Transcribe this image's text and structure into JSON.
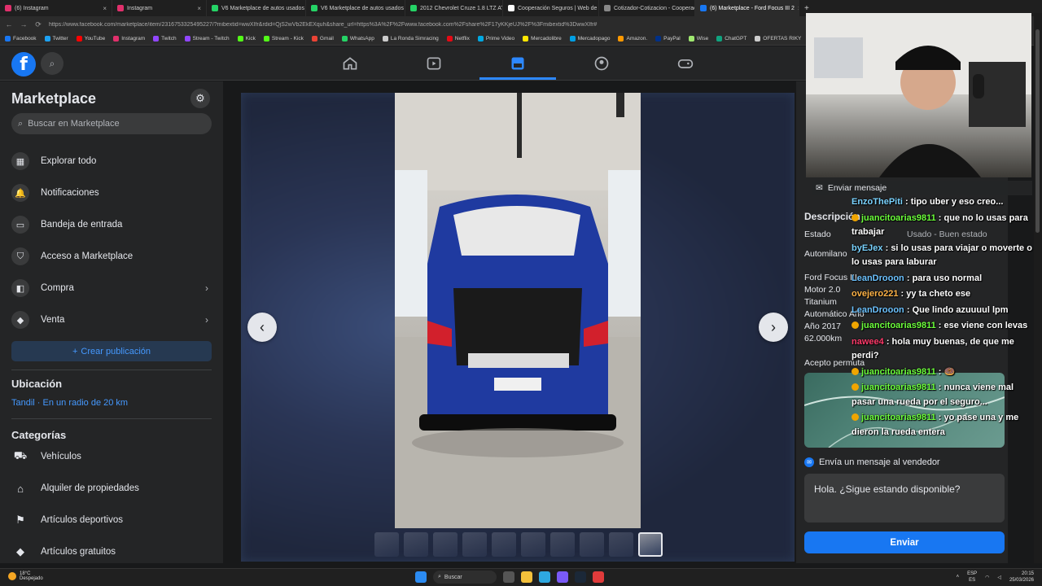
{
  "browser": {
    "tabs": [
      {
        "label": "(6) Instagram",
        "color": "#e1306c",
        "active": false
      },
      {
        "label": "Instagram",
        "color": "#e1306c",
        "active": false
      },
      {
        "label": "V6 Marketplace de autos usados",
        "color": "#25d366",
        "active": false
      },
      {
        "label": "V6 Marketplace de autos usados",
        "color": "#25d366",
        "active": false
      },
      {
        "label": "2012 Chevrolet Cruze 1.8 LTZ AT",
        "color": "#25d366",
        "active": false
      },
      {
        "label": "Cooperación Seguros | Web de Cl",
        "color": "#ffffff",
        "active": false
      },
      {
        "label": "Cotizador-Cotizacion - Cooperaci",
        "color": "#888888",
        "active": false
      },
      {
        "label": "(6) Marketplace - Ford Focus III 2",
        "color": "#1877f2",
        "active": true
      }
    ],
    "new_tab": "+",
    "url": "https://www.facebook.com/marketplace/item/2316753325495227/?mibextid=wwXIfr&rdid=QjS2wVb2EkEXquh&share_url=https%3A%2F%2Fwww.facebook.com%2Fshare%2F17yKKjeUJ%2F%3Fmibextid%3DwwXIfr#",
    "bookmarks": [
      {
        "label": "Facebook",
        "color": "#1877f2"
      },
      {
        "label": "Twitter",
        "color": "#1da1f2"
      },
      {
        "label": "YouTube",
        "color": "#ff0000"
      },
      {
        "label": "Instagram",
        "color": "#e1306c"
      },
      {
        "label": "Twitch",
        "color": "#9146ff"
      },
      {
        "label": "Stream - Twitch",
        "color": "#9146ff"
      },
      {
        "label": "Kick",
        "color": "#53fc18"
      },
      {
        "label": "Stream - Kick",
        "color": "#53fc18"
      },
      {
        "label": "Gmail",
        "color": "#ea4335"
      },
      {
        "label": "WhatsApp",
        "color": "#25d366"
      },
      {
        "label": "La Ronda Simracing",
        "color": "#cccccc"
      },
      {
        "label": "Netflix",
        "color": "#e50914"
      },
      {
        "label": "Prime Video",
        "color": "#00a8e1"
      },
      {
        "label": "Mercadolibre",
        "color": "#ffe600"
      },
      {
        "label": "Mercadopago",
        "color": "#009ee3"
      },
      {
        "label": "Amazon.",
        "color": "#ff9900"
      },
      {
        "label": "PayPal",
        "color": "#003087"
      },
      {
        "label": "Wise",
        "color": "#9fe870"
      },
      {
        "label": "ChatGPT",
        "color": "#10a37f"
      },
      {
        "label": "OFERTAS RIKY",
        "color": "#cccccc"
      }
    ]
  },
  "fb": {
    "logo": "f",
    "accent": "#1877f2"
  },
  "sidebar": {
    "title": "Marketplace",
    "search_placeholder": "Buscar en Marketplace",
    "items": [
      {
        "label": "Explorar todo",
        "icon": "store-icon",
        "glyph": "▦",
        "chevron": false
      },
      {
        "label": "Notificaciones",
        "icon": "bell-icon",
        "glyph": "🔔",
        "chevron": false
      },
      {
        "label": "Bandeja de entrada",
        "icon": "inbox-icon",
        "glyph": "▭",
        "chevron": false
      },
      {
        "label": "Acceso a Marketplace",
        "icon": "shield-icon",
        "glyph": "⛉",
        "chevron": false
      },
      {
        "label": "Compra",
        "icon": "bag-icon",
        "glyph": "◧",
        "chevron": true
      },
      {
        "label": "Venta",
        "icon": "tag-icon",
        "glyph": "◆",
        "chevron": true
      }
    ],
    "create_label": "Crear publicación",
    "location_heading": "Ubicación",
    "location_value": "Tandil · En un radio de 20 km",
    "categories_heading": "Categorías",
    "categories": [
      {
        "label": "Vehículos",
        "icon": "car-icon",
        "glyph": "⛟"
      },
      {
        "label": "Alquiler de propiedades",
        "icon": "home-dollar-icon",
        "glyph": "⌂"
      },
      {
        "label": "Artículos deportivos",
        "icon": "running-icon",
        "glyph": "⚑"
      },
      {
        "label": "Artículos gratuitos",
        "icon": "tag-free-icon",
        "glyph": "◆"
      }
    ]
  },
  "listing": {
    "description_heading": "Descripción",
    "estado_label": "Estado",
    "estado_value": "Usado - Buen estado",
    "lines": [
      "Automilano",
      "Ford Focus III",
      "Motor 2.0",
      "Titanium",
      "Automático Año",
      "Año 2017",
      "62.000km",
      "Acepto permuta"
    ],
    "message_heading": "Envía un mensaje al vendedor",
    "message_value": "Hola. ¿Sigue estando disponible?",
    "send_label": "Enviar",
    "send_message_label": "Enviar mensaje"
  },
  "chat": [
    {
      "user": "EnzoThePiti",
      "color": "#7ad3ff",
      "badge": false,
      "text": ": tipo uber y eso creo..."
    },
    {
      "user": "juancitoarias9811",
      "color": "#6cff3b",
      "badge": true,
      "text": ": que no lo usas para trabajar"
    },
    {
      "user": "byEJex",
      "color": "#7ad3ff",
      "badge": false,
      "text": ": si lo usas para viajar o moverte o lo usas para laburar"
    },
    {
      "user": "LeanDrooon",
      "color": "#6cc2ff",
      "badge": false,
      "text": ": para uso normal"
    },
    {
      "user": "ovejero221",
      "color": "#ffb347",
      "badge": false,
      "text": ": yy ta cheto ese"
    },
    {
      "user": "LeanDrooon",
      "color": "#6cc2ff",
      "badge": false,
      "text": ": Que lindo azuuuul lpm"
    },
    {
      "user": "juancitoarias9811",
      "color": "#6cff3b",
      "badge": true,
      "text": ": ese viene con levas"
    },
    {
      "user": "nawee4",
      "color": "#ff3b6b",
      "badge": false,
      "text": ": hola muy buenas, de que me perdi?"
    },
    {
      "user": "juancitoarias9811",
      "color": "#6cff3b",
      "badge": true,
      "text": ": 🍩"
    },
    {
      "user": "juancitoarias9811",
      "color": "#6cff3b",
      "badge": true,
      "text": ": nunca viene mal pasar una rueda por el seguro..."
    },
    {
      "user": "juancitoarias9811",
      "color": "#6cff3b",
      "badge": true,
      "text": ": yo pase una y me dieron la rueda entera"
    }
  ],
  "taskbar": {
    "weather_temp": "18°C",
    "weather_desc": "Despejado",
    "search_label": "Buscar",
    "lang": "ESP",
    "lang_sub": "ES",
    "time": "20:15",
    "date": "25/03/2026"
  },
  "gallery": {
    "thumb_count": 10,
    "active_thumb": 9,
    "prev": "‹",
    "next": "›"
  }
}
